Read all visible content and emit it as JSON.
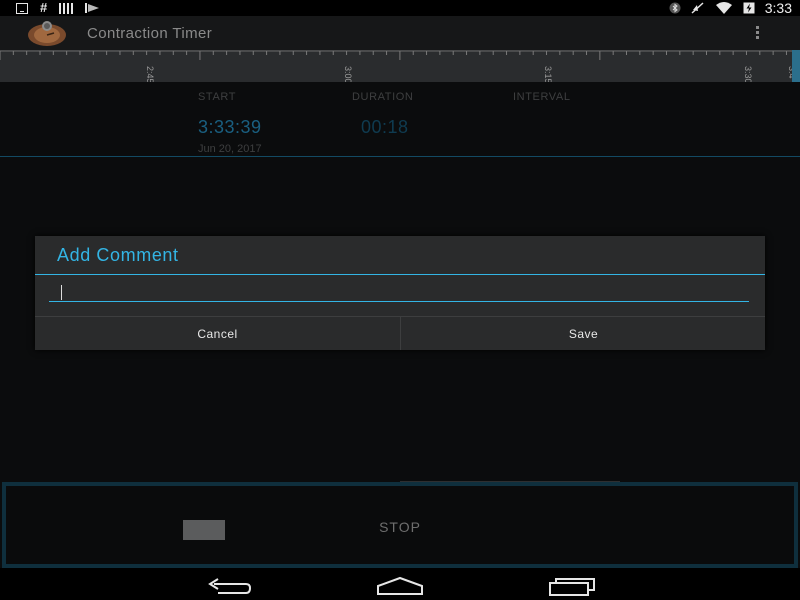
{
  "status_bar": {
    "time": "3:33",
    "left_icons": [
      "download-icon",
      "hash-icon",
      "barcode-icon",
      "flag-icon"
    ],
    "right_icons": [
      "bluetooth-icon",
      "mute-icon",
      "wifi-icon",
      "battery-icon"
    ]
  },
  "action_bar": {
    "title": "Contraction Timer",
    "app_icon": "stopwatch-icon",
    "overflow_icon": "overflow-menu-icon"
  },
  "timeline": {
    "tick_labels": [
      "2:45",
      "3:00",
      "3:15",
      "3:30",
      "3:4"
    ]
  },
  "header": {
    "start_label": "START",
    "duration_label": "DURATION",
    "interval_label": "INTERVAL",
    "start_time": "3:33:39",
    "duration": "00:18",
    "start_date": "Jun 20, 2017"
  },
  "dialog": {
    "title": "Add Comment",
    "input_value": "",
    "cancel_label": "Cancel",
    "save_label": "Save"
  },
  "stop": {
    "label": "STOP"
  },
  "colors": {
    "accent": "#33b5e5",
    "timer_blue": "#1a5f80",
    "background": "#0b0c0d"
  }
}
